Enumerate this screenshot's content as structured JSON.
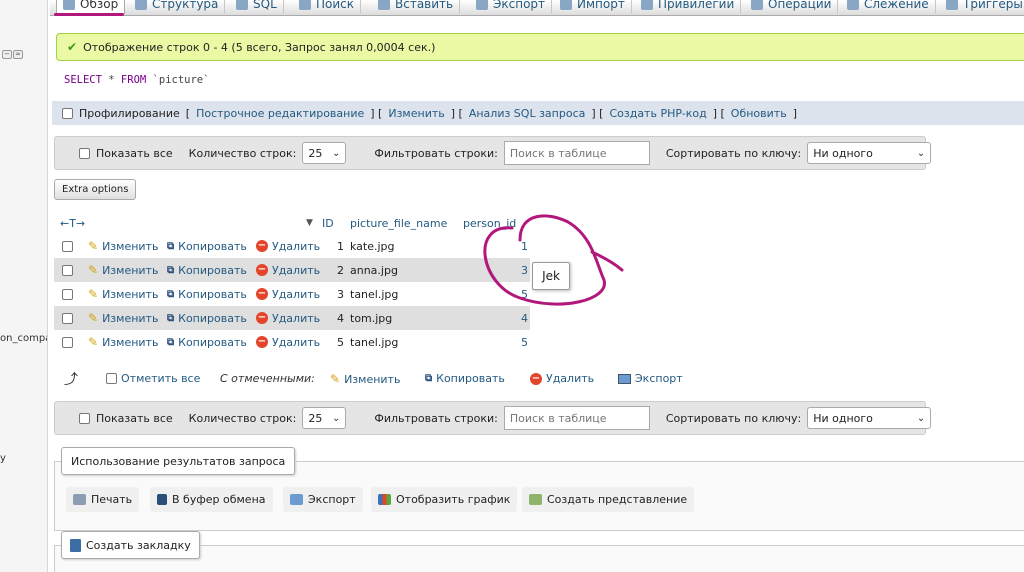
{
  "left_nav": {
    "frag1": "on_compa",
    "frag2": "y"
  },
  "tabs": [
    {
      "label": "Обзор",
      "icon": "browse-icon",
      "active": true
    },
    {
      "label": "Структура",
      "icon": "structure-icon"
    },
    {
      "label": "SQL",
      "icon": "sql-icon"
    },
    {
      "label": "Поиск",
      "icon": "search-icon"
    },
    {
      "label": "Вставить",
      "icon": "insert-icon"
    },
    {
      "label": "Экспорт",
      "icon": "export-icon"
    },
    {
      "label": "Импорт",
      "icon": "import-icon"
    },
    {
      "label": "Привилегии",
      "icon": "privileges-icon"
    },
    {
      "label": "Операции",
      "icon": "operations-icon"
    },
    {
      "label": "Слежение",
      "icon": "tracking-icon"
    },
    {
      "label": "Триггеры",
      "icon": "triggers-icon"
    }
  ],
  "success_message": "Отображение строк 0 - 4 (5 всего, Запрос занял 0,0004 сек.)",
  "sql": {
    "kw1": "SELECT",
    "star": "*",
    "kw2": "FROM",
    "table": "`picture`"
  },
  "profiling": {
    "label": "Профилирование",
    "links": [
      "Построчное редактирование",
      "Изменить",
      "Анализ SQL запроса",
      "Создать PHP-код",
      "Обновить"
    ]
  },
  "navbar": {
    "show_all": "Показать все",
    "rows_label": "Количество строк:",
    "rows_value": "25",
    "filter_label": "Фильтровать строки:",
    "filter_placeholder": "Поиск в таблице",
    "sort_label": "Сортировать по ключу:",
    "sort_value": "Ни одного"
  },
  "extra_options": "Extra options",
  "table": {
    "columns": [
      "ID",
      "picture_file_name",
      "person_id"
    ],
    "row_actions": {
      "edit": "Изменить",
      "copy": "Копировать",
      "delete": "Удалить"
    },
    "rows": [
      {
        "id": "1",
        "name": "kate.jpg",
        "pid": "1"
      },
      {
        "id": "2",
        "name": "anna.jpg",
        "pid": "3"
      },
      {
        "id": "3",
        "name": "tanel.jpg",
        "pid": "5"
      },
      {
        "id": "4",
        "name": "tom.jpg",
        "pid": "4"
      },
      {
        "id": "5",
        "name": "tanel.jpg",
        "pid": "5"
      }
    ]
  },
  "bulk": {
    "check_all": "Отметить все",
    "with_selected": "С отмеченными:",
    "edit": "Изменить",
    "copy": "Копировать",
    "delete": "Удалить",
    "export": "Экспорт"
  },
  "query_ops": {
    "legend": "Использование результатов запроса",
    "buttons": [
      "Печать",
      "В буфер обмена",
      "Экспорт",
      "Отобразить график",
      "Создать представление"
    ]
  },
  "bookmark": {
    "label": "Создать закладку"
  },
  "tooltip": "Jek",
  "colors": {
    "accent": "#b2187c",
    "link": "#235a81",
    "success_bg": "#ebf8a4"
  }
}
